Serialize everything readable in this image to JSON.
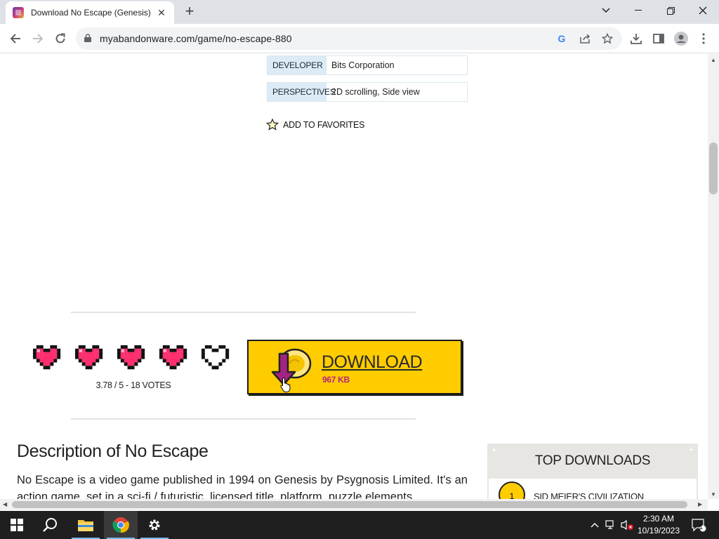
{
  "browser": {
    "tab_title": "Download No Escape (Genesis) -",
    "tab_close": "✕",
    "new_tab": "+",
    "url": "myabandonware.com/game/no-escape-880",
    "window_controls": [
      "minimize-icon",
      "restore-icon",
      "close-icon"
    ],
    "tab_search_icon": "chevron-down-icon"
  },
  "game_info": {
    "rows": [
      {
        "label": "DEVELOPER",
        "value": "Bits Corporation"
      },
      {
        "label": "PERSPECTIVES",
        "value": "2D scrolling, Side view"
      }
    ],
    "favorites_label": "ADD TO FAVORITES"
  },
  "rating": {
    "hearts_filled": 4,
    "hearts_total": 5,
    "score_text": "3.78 / 5 - 18 VOTES"
  },
  "download": {
    "label": "DOWNLOAD",
    "size": "967 KB"
  },
  "description": {
    "title": "Description of No Escape",
    "text": "No Escape is a video game published in 1994 on Genesis by Psygnosis Limited. It's an action game, set in a sci-fi / futuristic, licensed title, platform, puzzle elements"
  },
  "top_downloads": {
    "title": "TOP DOWNLOADS",
    "items": [
      {
        "rank": "1",
        "name": "SID MEIER'S CIVILIZATION"
      }
    ]
  },
  "taskbar": {
    "time": "2:30 AM",
    "date": "10/19/2023",
    "notification_count": "1"
  },
  "colors": {
    "download_button": "#ffcc00",
    "heart_fill": "#ff2d6e",
    "info_label_bg": "#dcebf5",
    "size_text": "#b8227e"
  }
}
